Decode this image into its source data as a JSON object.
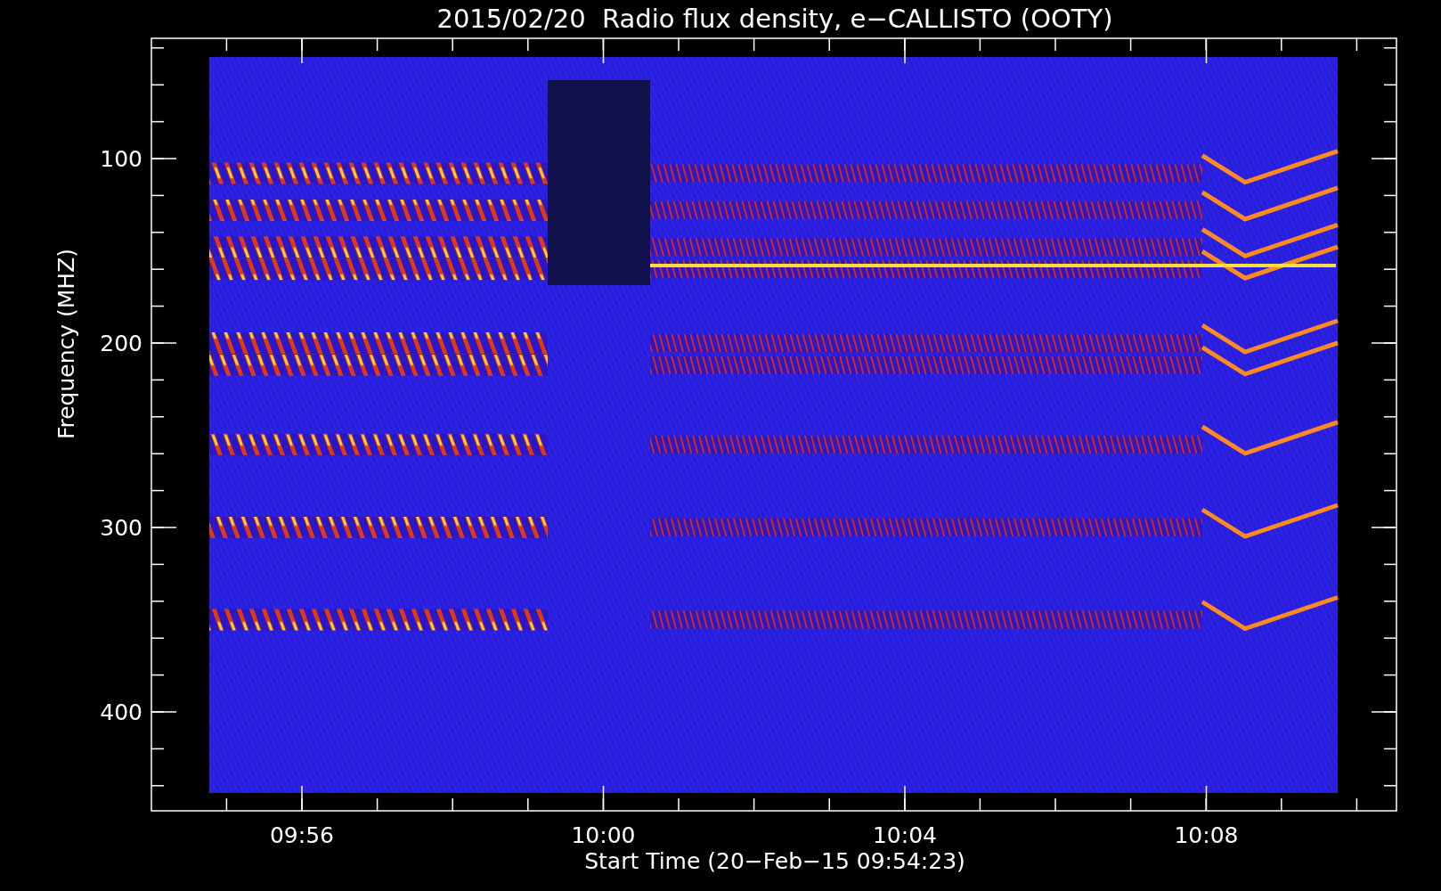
{
  "title": "2015/02/20  Radio flux density, e−CALLISTO (OOTY)",
  "y_axis": {
    "label": "Frequency (MHZ)",
    "ticks": [
      "100",
      "200",
      "300",
      "400"
    ]
  },
  "x_axis": {
    "label": "Start Time (20−Feb−15 09:54:23)",
    "ticks": [
      "09:56",
      "10:00",
      "10:04",
      "10:08"
    ]
  }
}
